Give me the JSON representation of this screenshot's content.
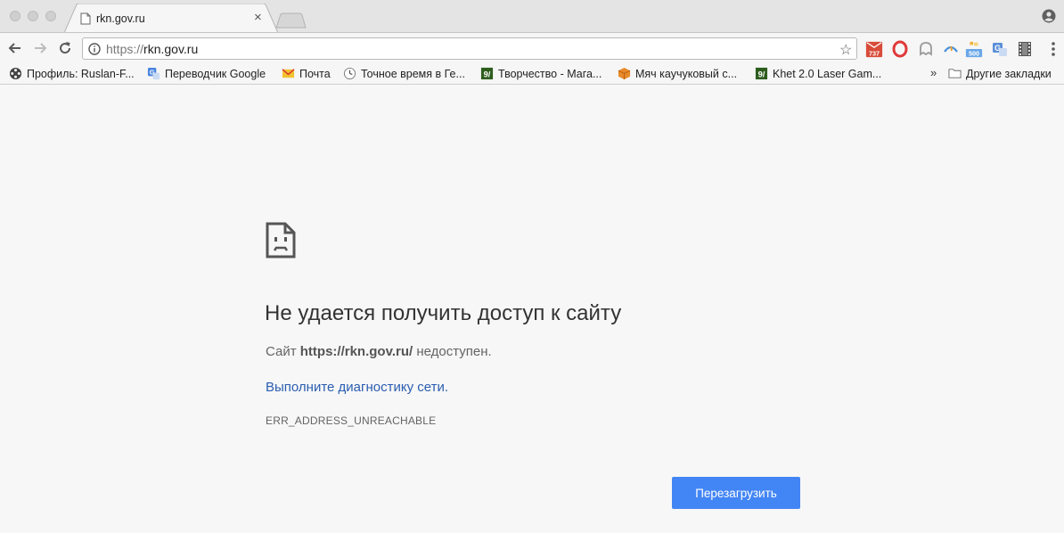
{
  "tab": {
    "title": "rkn.gov.ru",
    "close": "×"
  },
  "address_bar": {
    "scheme": "https://",
    "host": "rkn.gov.ru"
  },
  "extensions": [
    {
      "icon": "mail-counter-icon",
      "badge": "737",
      "color": "#d84b3a"
    },
    {
      "icon": "opera-icon",
      "color": "#e03a3a"
    },
    {
      "icon": "ghostery-icon",
      "color": "#9a9a9a"
    },
    {
      "icon": "weather-icon",
      "color": "#4a90d9"
    },
    {
      "icon": "counter-icon",
      "badge": "500",
      "color": "#6aa6e8"
    },
    {
      "icon": "translate-icon",
      "color": "#5b8fd8"
    },
    {
      "icon": "film-icon",
      "color": "#555555"
    }
  ],
  "bookmarks": {
    "items": [
      {
        "label": "Профиль: Ruslan-F..."
      },
      {
        "label": "Переводчик Google"
      },
      {
        "label": "Почта"
      },
      {
        "label": "Точное время в Ге..."
      },
      {
        "label": "Творчество - Мага..."
      },
      {
        "label": "Мяч каучуковый с..."
      },
      {
        "label": "Khet 2.0 Laser Gam..."
      }
    ],
    "more": "»",
    "other_folder": "Другие закладки"
  },
  "error": {
    "title": "Не удается получить доступ к сайту",
    "desc_prefix": "Сайт ",
    "desc_site": "https://rkn.gov.ru/",
    "desc_suffix": " недоступен.",
    "diagnostics_link": "Выполните диагностику сети.",
    "code": "ERR_ADDRESS_UNREACHABLE",
    "reload_label": "Перезагрузить"
  },
  "colors": {
    "accent_button": "#4285f4",
    "link": "#2a5db0",
    "page_bg": "#f7f7f7"
  }
}
